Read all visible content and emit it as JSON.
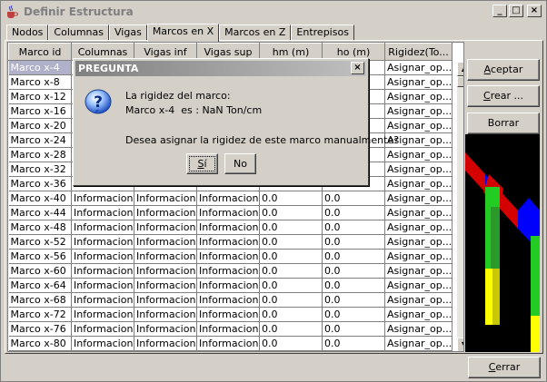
{
  "window": {
    "title": "Definir Estructura",
    "controls": {
      "minimize": "_",
      "maximize": "□",
      "close": "×"
    }
  },
  "tabs": [
    {
      "label": "Nodos",
      "active": false
    },
    {
      "label": "Columnas",
      "active": false
    },
    {
      "label": "Vigas",
      "active": false
    },
    {
      "label": "Marcos en X",
      "active": true
    },
    {
      "label": "Marcos en Z",
      "active": false
    },
    {
      "label": "Entrepisos",
      "active": false
    }
  ],
  "table": {
    "columns": [
      "Marco id",
      "Columnas",
      "Vigas inf",
      "Vigas sup",
      "hm (m)",
      "ho (m)",
      "Rigidez(To..."
    ],
    "rows": [
      [
        "Marco x-4",
        "",
        "",
        "",
        "",
        "",
        "Asignar_op..."
      ],
      [
        "Marco x-8",
        "",
        "",
        "",
        "",
        "",
        "Asignar_op..."
      ],
      [
        "Marco x-12",
        "",
        "",
        "",
        "",
        "",
        "Asignar_op..."
      ],
      [
        "Marco x-16",
        "",
        "",
        "",
        "",
        "",
        "Asignar_op..."
      ],
      [
        "Marco x-20",
        "",
        "",
        "",
        "",
        "",
        "Asignar_op..."
      ],
      [
        "Marco x-24",
        "",
        "",
        "",
        "",
        "",
        "Asignar_op..."
      ],
      [
        "Marco x-28",
        "",
        "",
        "",
        "",
        "",
        "Asignar_op..."
      ],
      [
        "Marco x-32",
        "",
        "",
        "",
        "",
        "",
        "Asignar_op..."
      ],
      [
        "Marco x-36",
        "",
        "",
        "",
        "",
        "",
        "Asignar_op..."
      ],
      [
        "Marco x-40",
        "Informacion",
        "Informacion",
        "Informacion",
        "0.0",
        "0.0",
        "Asignar_op..."
      ],
      [
        "Marco x-44",
        "Informacion",
        "Informacion",
        "Informacion",
        "0.0",
        "0.0",
        "Asignar_op..."
      ],
      [
        "Marco x-48",
        "Informacion",
        "Informacion",
        "Informacion",
        "0.0",
        "0.0",
        "Asignar_op..."
      ],
      [
        "Marco x-52",
        "Informacion",
        "Informacion",
        "Informacion",
        "0.0",
        "0.0",
        "Asignar_op..."
      ],
      [
        "Marco x-56",
        "Informacion",
        "Informacion",
        "Informacion",
        "0.0",
        "0.0",
        "Asignar_op..."
      ],
      [
        "Marco x-60",
        "Informacion",
        "Informacion",
        "Informacion",
        "0.0",
        "0.0",
        "Asignar_op..."
      ],
      [
        "Marco x-64",
        "Informacion",
        "Informacion",
        "Informacion",
        "0.0",
        "0.0",
        "Asignar_op..."
      ],
      [
        "Marco x-68",
        "Informacion",
        "Informacion",
        "Informacion",
        "0.0",
        "0.0",
        "Asignar_op..."
      ],
      [
        "Marco x-72",
        "Informacion",
        "Informacion",
        "Informacion",
        "0.0",
        "0.0",
        "Asignar_op..."
      ],
      [
        "Marco x-76",
        "Informacion",
        "Informacion",
        "Informacion",
        "0.0",
        "0.0",
        "Asignar_op..."
      ],
      [
        "Marco x-80",
        "Informacion",
        "Informacion",
        "Informacion",
        "0.0",
        "0.0",
        "Asignar_op..."
      ]
    ],
    "selected_row": 0
  },
  "side_buttons": {
    "accept": {
      "label_u": "A",
      "label_rest": "ceptar"
    },
    "create": {
      "label_u": "C",
      "label_rest": "rear ..."
    },
    "delete": {
      "label": "Borrar"
    }
  },
  "dialog": {
    "title": "PREGUNTA",
    "line1": "La rigidez del marco:",
    "line2": "Marco x-4  es : NaN Ton/cm",
    "line3": "Desea asignar la rigidez de este marco manualmente?",
    "yes_u": "S",
    "yes_rest": "í",
    "no": "No"
  },
  "footer": {
    "close_u": "C",
    "close_rest": "errar"
  },
  "colors": {
    "dialog_title_start": "#808080",
    "dialog_title_end": "#c0c0c0",
    "selected_row": "#b0b0c8",
    "view_red": "#d40000",
    "view_blue": "#0000ff",
    "view_green": "#22cc22",
    "view_yellow": "#ffff00"
  }
}
